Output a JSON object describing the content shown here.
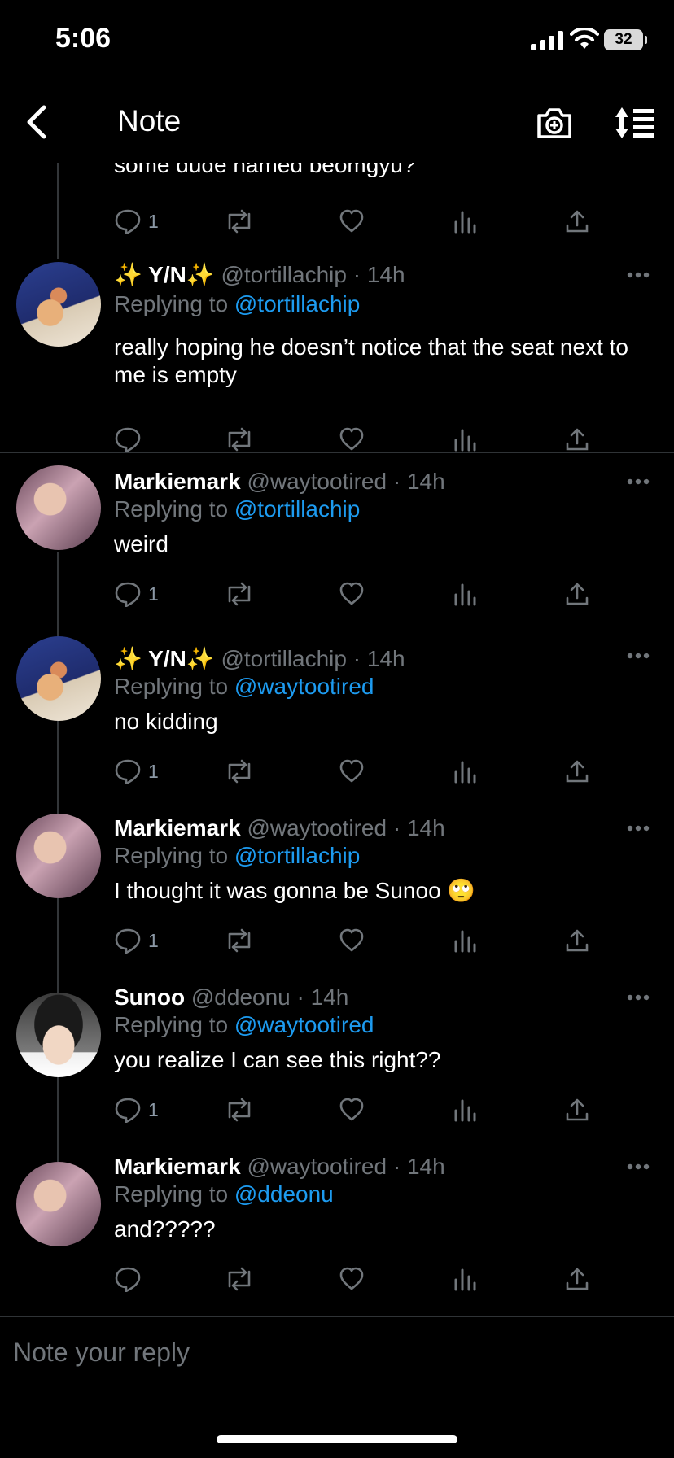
{
  "status_bar": {
    "time": "5:06",
    "battery": "32"
  },
  "header": {
    "title": "Note"
  },
  "top_post": {
    "text_tail": "some dude named beomgyu?",
    "reply_count": "1"
  },
  "posts": [
    {
      "name": "✨ Y/N✨",
      "handle": "@tortillachip",
      "sep": "·",
      "time": "14h",
      "replying_prefix": "Replying to",
      "replying_to": "@tortillachip",
      "text": "really hoping he doesn’t notice that the seat next to me is empty",
      "reply_count": ""
    },
    {
      "name": "Markiemark",
      "handle": "@waytootired",
      "sep": "·",
      "time": "14h",
      "replying_prefix": "Replying to",
      "replying_to": "@tortillachip",
      "text": "weird",
      "reply_count": "1"
    },
    {
      "name": "✨ Y/N✨",
      "handle": "@tortillachip",
      "sep": "·",
      "time": "14h",
      "replying_prefix": "Replying to",
      "replying_to": "@waytootired",
      "text": "no kidding",
      "reply_count": "1"
    },
    {
      "name": "Markiemark",
      "handle": "@waytootired",
      "sep": "·",
      "time": "14h",
      "replying_prefix": "Replying to",
      "replying_to": "@tortillachip",
      "text": "I thought it was gonna be Sunoo 🙄",
      "reply_count": "1"
    },
    {
      "name": "Sunoo",
      "handle": "@ddeonu",
      "sep": "·",
      "time": "14h",
      "replying_prefix": "Replying to",
      "replying_to": "@waytootired",
      "text": "you realize I can see this right??",
      "reply_count": "1"
    },
    {
      "name": "Markiemark",
      "handle": "@waytootired",
      "sep": "·",
      "time": "14h",
      "replying_prefix": "Replying to",
      "replying_to": "@ddeonu",
      "text": "and?????",
      "reply_count": ""
    }
  ],
  "composer": {
    "placeholder": "Note your reply"
  },
  "colors": {
    "background": "#000000",
    "mention": "#1d9bf0",
    "muted": "#71767b",
    "text": "#ffffff"
  },
  "icons": [
    "back-arrow-icon",
    "camera-plus-icon",
    "sort-icon",
    "reply-icon",
    "retweet-icon",
    "like-icon",
    "views-icon",
    "share-icon",
    "more-icon"
  ]
}
